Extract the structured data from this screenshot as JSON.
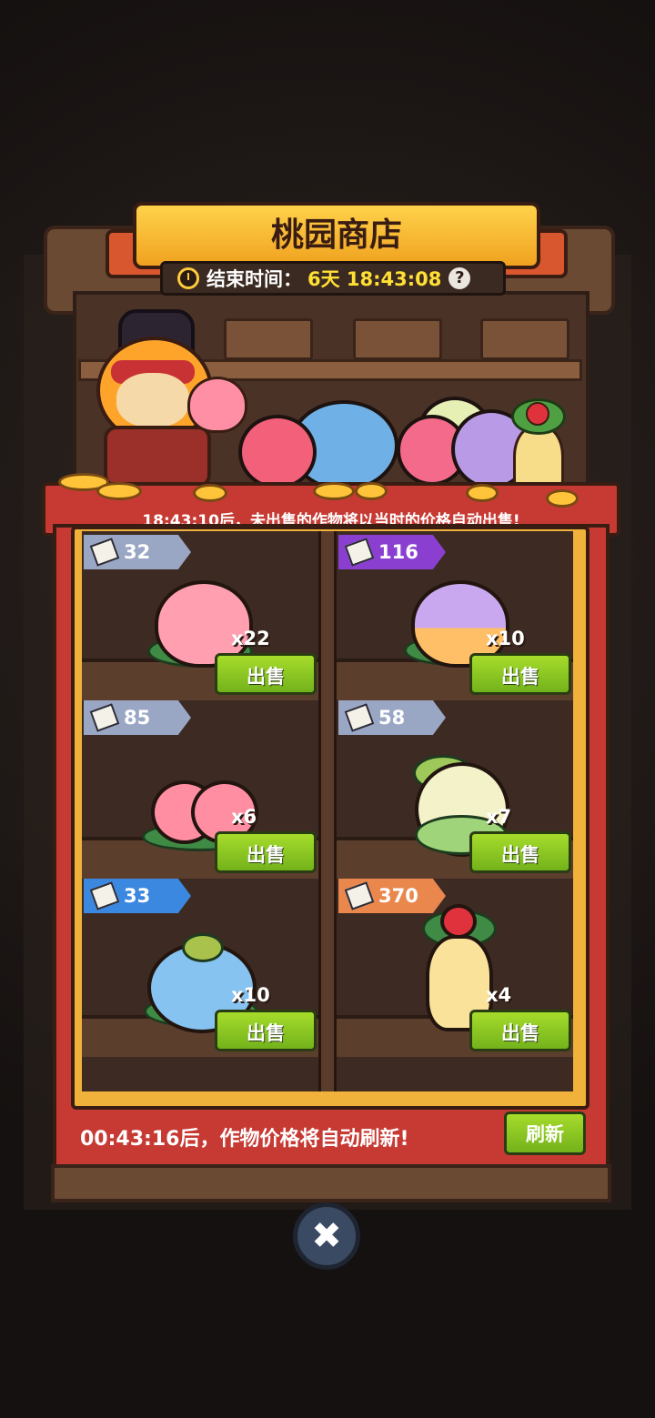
{
  "header": {
    "title": "桃园商店",
    "end_time_label": "结束时间：",
    "end_time_value": "6天 18:43:08",
    "help_symbol": "?"
  },
  "notice": "18:43:10后，未出售的作物将以当时的价格自动出售!",
  "items": [
    {
      "price": "32",
      "tag": "gray",
      "qty": "x22",
      "sell_label": "出售",
      "crop": "peach",
      "colors": {
        "body": "#ff9fb0"
      }
    },
    {
      "price": "116",
      "tag": "purple",
      "qty": "x10",
      "sell_label": "出售",
      "crop": "purple-peach",
      "colors": {
        "body": "#c9a8ef"
      }
    },
    {
      "price": "85",
      "tag": "gray",
      "qty": "x6",
      "sell_label": "出售",
      "crop": "twin-peach",
      "colors": {
        "body": "#ff8ea2"
      }
    },
    {
      "price": "58",
      "tag": "gray",
      "qty": "x7",
      "sell_label": "出售",
      "crop": "cabbage",
      "colors": {
        "body": "#f4f2c8"
      }
    },
    {
      "price": "33",
      "tag": "blue",
      "qty": "x10",
      "sell_label": "出售",
      "crop": "blue-bulb",
      "colors": {
        "body": "#86c3f0"
      }
    },
    {
      "price": "370",
      "tag": "orange",
      "qty": "x4",
      "sell_label": "出售",
      "crop": "mandrake",
      "colors": {
        "body": "#fbe29a"
      }
    }
  ],
  "footer": {
    "refresh_notice": "00:43:16后，作物价格将自动刷新!",
    "refresh_label": "刷新"
  },
  "close_symbol": "✖",
  "colors": {
    "sell_button": "#8cc625",
    "banner": "#f7b82c",
    "counter": "#c73a33"
  }
}
